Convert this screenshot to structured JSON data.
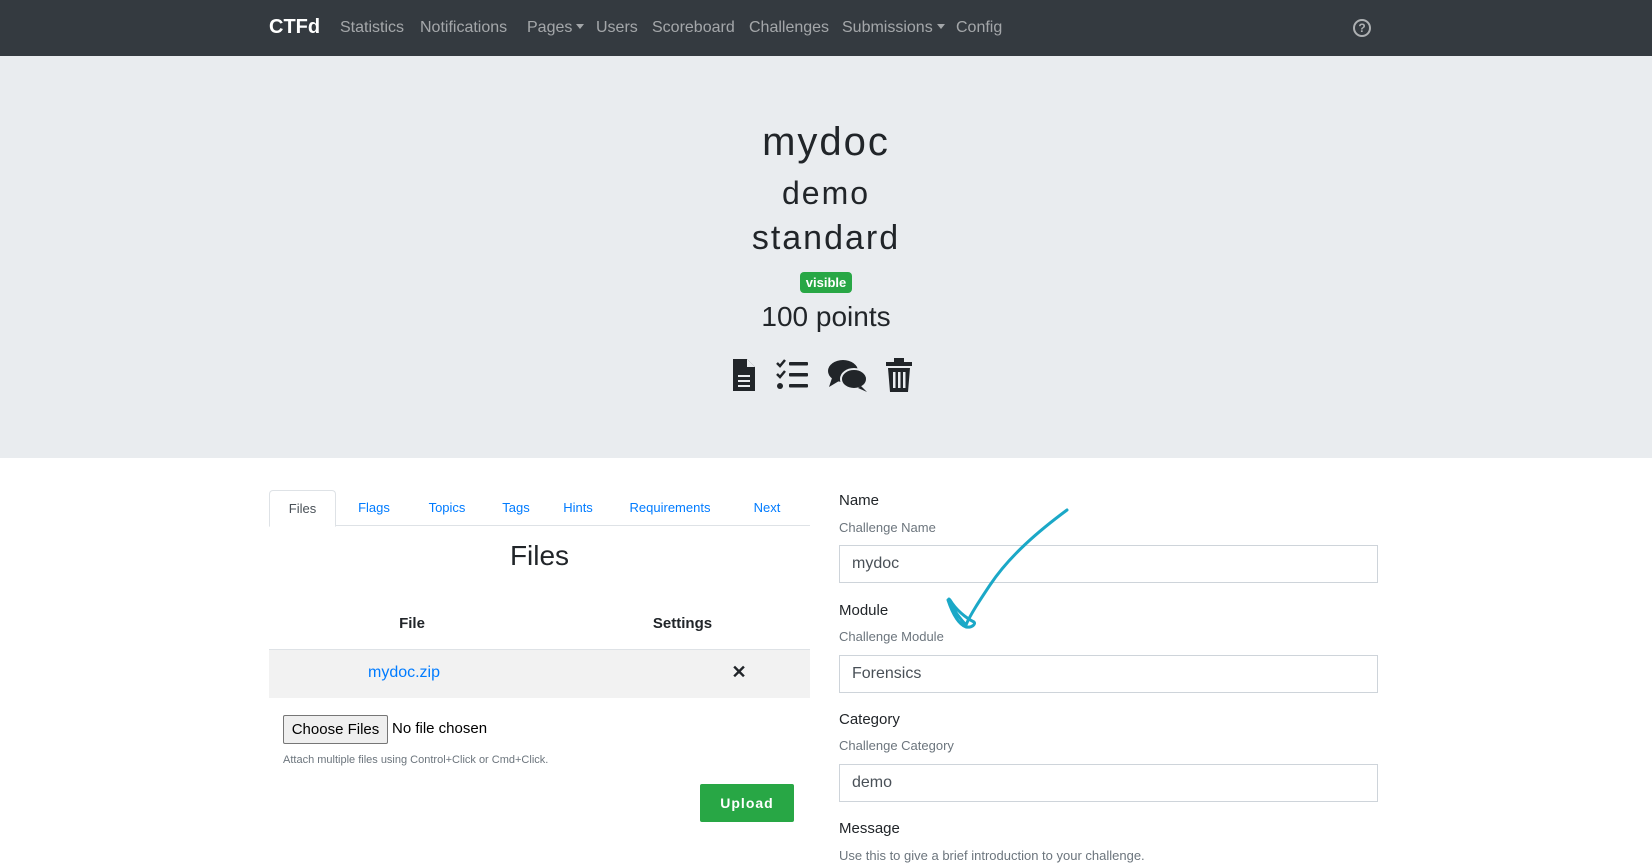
{
  "navbar": {
    "brand": "CTFd",
    "items": [
      {
        "label": "Statistics",
        "dropdown": false
      },
      {
        "label": "Notifications",
        "dropdown": false
      },
      {
        "label": "Pages",
        "dropdown": true
      },
      {
        "label": "Users",
        "dropdown": false
      },
      {
        "label": "Scoreboard",
        "dropdown": false
      },
      {
        "label": "Challenges",
        "dropdown": false
      },
      {
        "label": "Submissions",
        "dropdown": true
      },
      {
        "label": "Config",
        "dropdown": false
      }
    ],
    "help_icon": "question-circle-icon",
    "background": "#343a40"
  },
  "challenge": {
    "name": "mydoc",
    "category": "demo",
    "type": "standard",
    "state": "visible",
    "points": "100 points",
    "actions": [
      "file-icon",
      "checklist-icon",
      "comments-icon",
      "trash-icon"
    ]
  },
  "tabs": [
    {
      "label": "Files",
      "active": true
    },
    {
      "label": "Flags",
      "active": false
    },
    {
      "label": "Topics",
      "active": false
    },
    {
      "label": "Tags",
      "active": false
    },
    {
      "label": "Hints",
      "active": false
    },
    {
      "label": "Requirements",
      "active": false
    },
    {
      "label": "Next",
      "active": false
    }
  ],
  "files": {
    "title": "Files",
    "headers": [
      "File",
      "Settings"
    ],
    "rows": [
      {
        "file": "mydoc.zip",
        "settings": "✕"
      }
    ],
    "choose_label": "Choose Files",
    "no_file": "No file chosen",
    "help": "Attach multiple files using Control+Click or Cmd+Click.",
    "upload": "Upload"
  },
  "form": {
    "name_label": "Name",
    "name_help": "Challenge Name",
    "name_value": "mydoc",
    "module_label": "Module",
    "module_help": "Challenge Module",
    "module_value": "Forensics",
    "category_label": "Category",
    "category_help": "Challenge Category",
    "category_value": "demo",
    "message_label": "Message",
    "message_help": "Use this to give a brief introduction to your challenge."
  },
  "colors": {
    "success": "#28a745",
    "link": "#007bff",
    "annotation": "#1ba8c7"
  }
}
